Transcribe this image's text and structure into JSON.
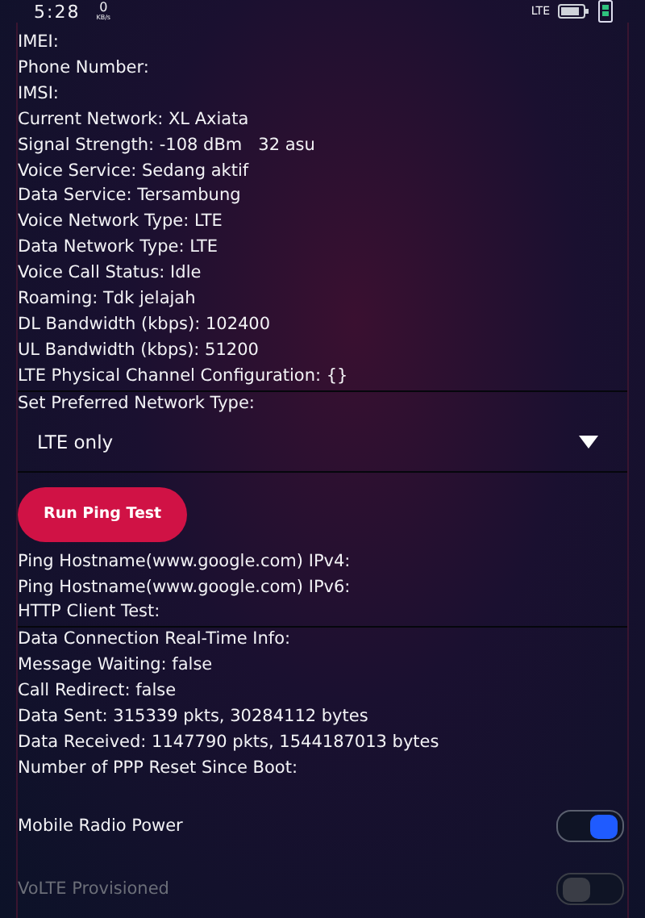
{
  "status_bar": {
    "time": "5:28",
    "speed": "0",
    "speed_unit": "KB/s",
    "network": "LTE"
  },
  "info_lines": [
    "IMEI:",
    "Phone Number:",
    "IMSI:",
    "Current Network: XL Axiata",
    "Signal Strength: -108 dBm   32 asu",
    "Voice Service: Sedang aktif",
    "Data Service: Tersambung",
    "Voice Network Type: LTE",
    "Data Network Type: LTE",
    "Voice Call Status: Idle",
    "Roaming: Tdk jelajah",
    "DL Bandwidth (kbps): 102400",
    "UL Bandwidth (kbps): 51200",
    "LTE Physical Channel Configuration: {}"
  ],
  "preferred_network": {
    "label": "Set Preferred Network Type:",
    "value": "LTE only"
  },
  "ping_button": "Run Ping Test",
  "ping_lines": [
    "Ping Hostname(www.google.com) IPv4:",
    "Ping Hostname(www.google.com) IPv6:",
    "HTTP Client Test:"
  ],
  "data_lines": [
    "Data Connection Real-Time Info:",
    "Message Waiting: false",
    "Call Redirect: false",
    "Data Sent: 315339 pkts, 30284112 bytes",
    "Data Received: 1147790 pkts, 1544187013 bytes",
    "Number of PPP Reset Since Boot:"
  ],
  "toggles": [
    {
      "label": "Mobile Radio Power",
      "on": true,
      "disabled": false
    },
    {
      "label": "VoLTE Provisioned",
      "on": false,
      "disabled": true
    }
  ]
}
